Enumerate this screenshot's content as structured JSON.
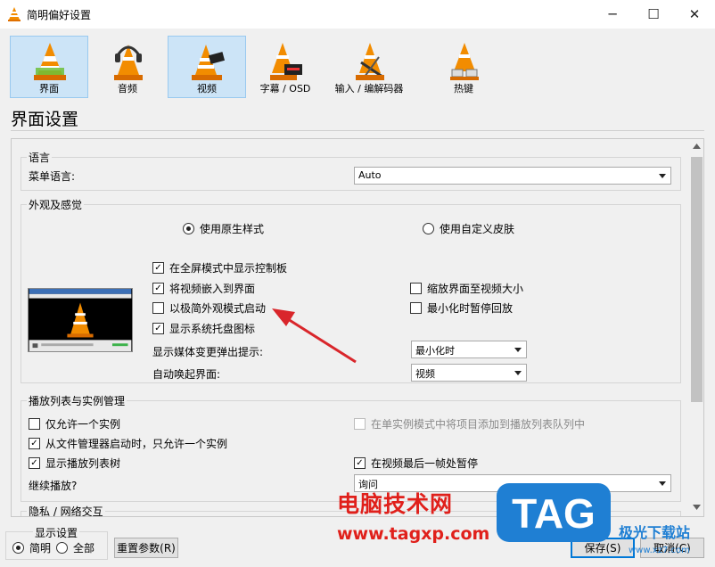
{
  "window": {
    "title": "简明偏好设置",
    "minimize": "─",
    "maximize": "☐",
    "close": "✕"
  },
  "categories": [
    {
      "label": "界面",
      "selected": true,
      "icon": "interface-cone-icon"
    },
    {
      "label": "音频",
      "selected": false,
      "icon": "audio-cone-icon"
    },
    {
      "label": "视频",
      "selected": true,
      "icon": "video-cone-icon"
    },
    {
      "label": "字幕 / OSD",
      "selected": false,
      "icon": "subtitles-cone-icon"
    },
    {
      "label": "输入 / 编解码器",
      "selected": false,
      "icon": "codec-cone-icon"
    },
    {
      "label": "热键",
      "selected": false,
      "icon": "hotkeys-cone-icon"
    }
  ],
  "section_title": "界面设置",
  "language": {
    "group_title": "语言",
    "menu_language_label": "菜单语言:",
    "menu_language_value": "Auto"
  },
  "look": {
    "group_title": "外观及感觉",
    "native_style": "使用原生样式",
    "custom_skin": "使用自定义皮肤",
    "options": {
      "fullscreen_controls": "在全屏模式中显示控制板",
      "embed_video": "将视频嵌入到界面",
      "minimal_mode": "以极简外观模式启动",
      "systray": "显示系统托盘图标",
      "resize_to_video": "缩放界面至视频大小",
      "pause_minimized": "最小化时暂停回放"
    },
    "popup_label": "显示媒体变更弹出提示:",
    "popup_value": "最小化时",
    "raise_label": "自动唤起界面:",
    "raise_value": "视频"
  },
  "playlist": {
    "group_title": "播放列表与实例管理",
    "one_instance": "仅允许一个实例",
    "enqueue": "在单实例模式中将项目添加到播放列表队列中",
    "file_manager": "从文件管理器启动时，只允许一个实例",
    "show_playlist": "显示播放列表树",
    "pause_last_frame": "在视频最后一帧处暂停",
    "continue_label": "继续播放?",
    "continue_value": "询问"
  },
  "privacy": {
    "group_title": "隐私 / 网络交互"
  },
  "bottom": {
    "display_settings": "显示设置",
    "simple": "简明",
    "all": "全部",
    "reset": "重置参数(R)",
    "save": "保存(S)",
    "cancel": "取消(C)"
  },
  "watermark": {
    "text": "电脑技术网",
    "url": "www.tagxp.com",
    "logo": "TAG",
    "site": "极光下载站",
    "site_url": "www.xz7.com"
  },
  "colors": {
    "selected_bg": "#cce4f7",
    "arrow": "#d9262b",
    "watermark_red": "#e0201b",
    "logo_blue": "#1f7fd3"
  }
}
